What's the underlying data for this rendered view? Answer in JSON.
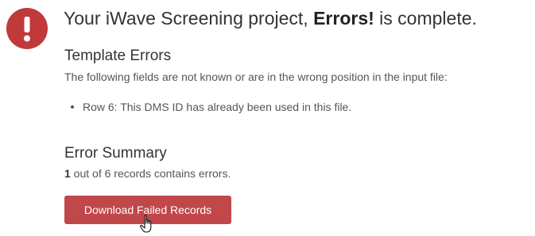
{
  "colors": {
    "error_red": "#c0393b",
    "button_red": "#c0474a"
  },
  "icons": {
    "status": "exclamation-circle-icon",
    "cursor": "hand-pointer-cursor"
  },
  "header": {
    "title_prefix": "Your iWave Screening project, ",
    "project_name": "Errors!",
    "title_suffix": " is complete."
  },
  "template_errors": {
    "heading": "Template Errors",
    "description": "The following fields are not known or are in the wrong position in the input file:",
    "items": [
      "Row 6: This DMS ID has already been used in this file."
    ]
  },
  "error_summary": {
    "heading": "Error Summary",
    "error_count": "1",
    "summary_text": " out of 6 records contains errors."
  },
  "actions": {
    "download_label": "Download Failed Records"
  }
}
